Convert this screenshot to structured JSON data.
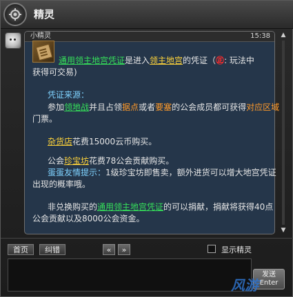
{
  "window": {
    "title": "精灵"
  },
  "message": {
    "sender": "小精灵",
    "time": "15:38",
    "item_icon": "scroll-icon",
    "l1": {
      "a": "通用领主地宫凭证",
      "b": "是进入",
      "c": "领主地宫",
      "d": "的凭证（",
      "e": "㊣",
      "f": ": 玩法中"
    },
    "l2": "获得可交易)",
    "l3": "凭证来源：",
    "l4": {
      "a": "参加",
      "b": "领地战",
      "c": "并且占领",
      "d": "据点",
      "e": "或者",
      "f": "要塞",
      "g": "的公会成员都可获得",
      "h": "对应区域"
    },
    "l5": "门票。",
    "l6": {
      "a": "杂货店",
      "b": "花费15000云币购买。"
    },
    "l7": {
      "a": "公会",
      "b": "珍宝坊",
      "c": "花费78公会贡献购买。"
    },
    "l8": {
      "a": "蛋蛋友情提示：",
      "b": "1级珍宝坊即售卖，额外进货可以增大地宫凭证"
    },
    "l9": "出现的概率哦。",
    "l10": {
      "a": "非兑换购买的",
      "b": "通用领主地宫凭证",
      "c": "的可以捐献，捐献将获得40点"
    },
    "l11": "公会贡献以及8000公会资金。"
  },
  "toolbar": {
    "home": "首页",
    "report": "纠错",
    "prev": "«",
    "next": "»",
    "show_sprite": "显示精灵"
  },
  "send": {
    "line1": "发送",
    "line2": "Enter"
  },
  "watermark": "风游",
  "icons": {
    "title": "gear-emblem-icon",
    "avatar": "sprite-avatar-icon"
  }
}
